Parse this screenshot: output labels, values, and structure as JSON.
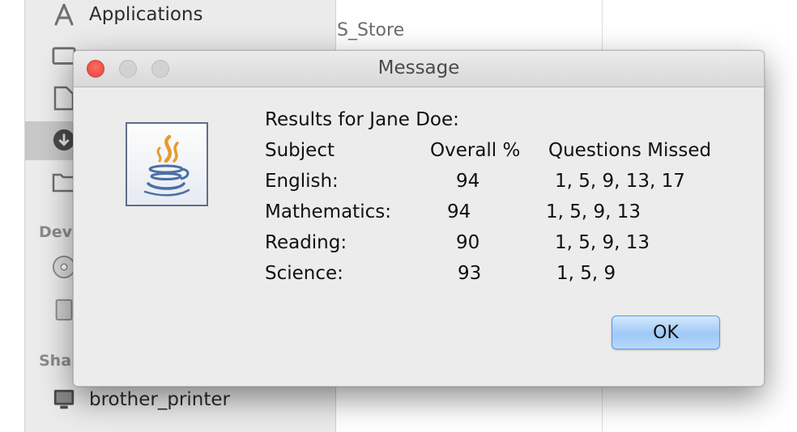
{
  "background": {
    "file_label": "S_Store",
    "sidebar": {
      "applications_label": "Applications",
      "devices_header": "Dev",
      "shared_header": "Sha",
      "printer_label": "brother_printer"
    }
  },
  "dialog": {
    "title": "Message",
    "heading": "Results for Jane Doe:",
    "columns": [
      "Subject",
      "Overall %",
      "Questions Missed"
    ],
    "rows": [
      {
        "subject": "English:",
        "overall": "94",
        "missed": "1, 5, 9, 13, 17"
      },
      {
        "subject": "Mathematics:",
        "overall": "94",
        "missed": "1, 5, 9, 13"
      },
      {
        "subject": "Reading:",
        "overall": "90",
        "missed": "1, 5, 9, 13"
      },
      {
        "subject": "Science:",
        "overall": "93",
        "missed": "1, 5, 9"
      }
    ],
    "ok_label": "OK"
  },
  "colors": {
    "close_button": "#ff5f57",
    "ok_button": "#a9d0f8",
    "java_orange": "#e89a2c",
    "java_blue": "#4c6fa6"
  },
  "icons": [
    "applications-icon",
    "desktop-icon",
    "documents-icon",
    "downloads-icon",
    "folder-icon",
    "disc-icon",
    "drive-icon",
    "display-icon",
    "java-logo-icon"
  ]
}
